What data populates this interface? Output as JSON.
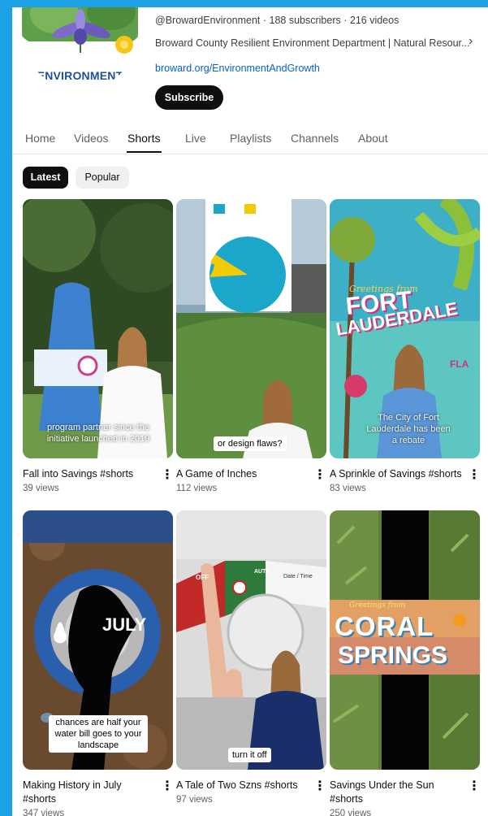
{
  "channel": {
    "brand_text": "ENVIRONMENT",
    "meta_line": "@BrowardEnvironment · 188 subscribers · 216 videos",
    "description": "Broward County Resilient Environment Department | Natural Resour...",
    "link": "broward.org/EnvironmentAndGrowth",
    "subscribe_label": "Subscribe"
  },
  "tabs": [
    "Home",
    "Videos",
    "Shorts",
    "Live",
    "Playlists",
    "Channels",
    "About"
  ],
  "active_tab": "Shorts",
  "chips": [
    "Latest",
    "Popular"
  ],
  "shorts": [
    {
      "title": "Fall into Savings #shorts",
      "views": "39 views",
      "overlay": "program partner since the initiative launched in 2019"
    },
    {
      "title": "A Game of Inches",
      "views": "112 views",
      "overlay": "or design flaws?"
    },
    {
      "title": "A Sprinkle of Savings #shorts",
      "views": "83 views",
      "overlay": "The City of Fort Lauderdale has been a rebate",
      "art_line1": "Greetings from",
      "art_line2": "FORT",
      "art_line3": "LAUDERDALE",
      "art_line4": "FLA"
    },
    {
      "title": "Making History in July #shorts",
      "views": "347 views",
      "overlay": "chances are half your water bill goes to your landscape",
      "art_text": "JULY"
    },
    {
      "title": "A Tale of Two Szns #shorts",
      "views": "97 views",
      "overlay": "turn it off",
      "art_off": "OFF",
      "art_auto": "AUTO",
      "art_date": "Date / Time"
    },
    {
      "title": "Savings Under the Sun #shorts",
      "views": "250 views",
      "art_line1": "Greetings from",
      "art_line2": "CORAL",
      "art_line3": "SPRINGS"
    }
  ],
  "colors": {
    "frame": "#1da1e6",
    "link": "#065fd4",
    "pie_main": "#1aa7c9",
    "pie_slice": "#f2cb05"
  },
  "kebab_icon": "⋮"
}
